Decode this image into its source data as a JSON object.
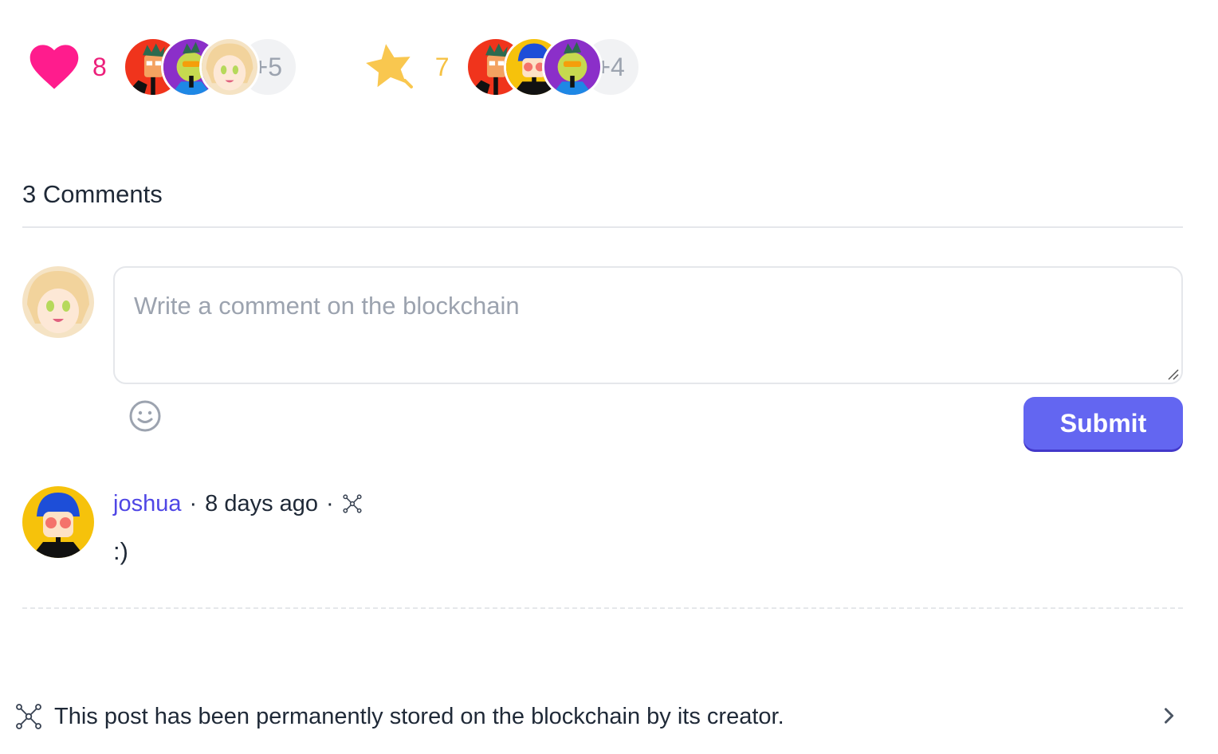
{
  "reactions": {
    "likes": {
      "icon": "heart-icon",
      "count": "8",
      "color": "#ec1f7a",
      "avatars": [
        "red-punk-avatar",
        "green-punk-avatar",
        "anime-girl-avatar"
      ],
      "more": "+5"
    },
    "mints": {
      "icon": "star-icon",
      "count": "7",
      "color": "#f6c244",
      "avatars": [
        "red-punk-avatar",
        "blue-hair-avatar",
        "green-punk-avatar"
      ],
      "more": "+4"
    }
  },
  "comments": {
    "title": "3 Comments",
    "input_placeholder": "Write a comment on the blockchain",
    "submit_label": "Submit",
    "items": [
      {
        "author": "joshua",
        "time": "8 days ago",
        "sep": "·",
        "text": ":)"
      }
    ]
  },
  "footer": {
    "text": "This post has been permanently stored on the blockchain by its creator."
  },
  "colors": {
    "accent": "#6366f1",
    "author_link": "#4f46e5",
    "border": "#e5e7eb"
  }
}
